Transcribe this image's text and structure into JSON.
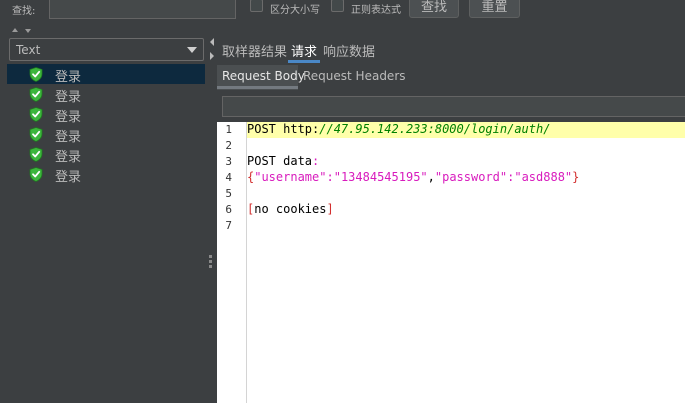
{
  "search": {
    "label": "查找:",
    "value": "",
    "case_sensitive_label": "区分大小写",
    "regex_label": "正则表达式",
    "find_button": "查找",
    "reset_button": "重置"
  },
  "renderer": {
    "selected": "Text"
  },
  "tree": {
    "items": [
      {
        "label": "登录",
        "status": "success"
      },
      {
        "label": "登录",
        "status": "success"
      },
      {
        "label": "登录",
        "status": "success"
      },
      {
        "label": "登录",
        "status": "success"
      },
      {
        "label": "登录",
        "status": "success"
      },
      {
        "label": "登录",
        "status": "success"
      }
    ]
  },
  "tabs": [
    {
      "label": "取样器结果"
    },
    {
      "label": "请求",
      "active": true
    },
    {
      "label": "响应数据"
    }
  ],
  "subtabs": [
    {
      "label": "Request Body",
      "active": true
    },
    {
      "label": "Request Headers"
    }
  ],
  "editor": {
    "line_numbers": [
      "1",
      "2",
      "3",
      "4",
      "5",
      "6",
      "7"
    ],
    "line1_method": "POST http:",
    "line1_url": "//47.95.142.233:8000/login/auth/",
    "line3": "POST data",
    "line3_colon": ":",
    "line4_open": "{",
    "line4_key1": "\"username\"",
    "line4_colon1": ":",
    "line4_val1": "\"13484545195\"",
    "line4_comma": ",",
    "line4_key2": "\"password\"",
    "line4_colon2": ":",
    "line4_val2": "\"asd888\"",
    "line4_close": "}",
    "line6_open": "[",
    "line6_text": "no cookies",
    "line6_close": "]"
  },
  "colors": {
    "background": "#3c3f41",
    "selection": "#0d293e",
    "current_line": "#ffffaa",
    "url": "#008000",
    "json_string": "#d81bbd",
    "brace": "#d32f2f",
    "status_success": "#3cb53c"
  }
}
